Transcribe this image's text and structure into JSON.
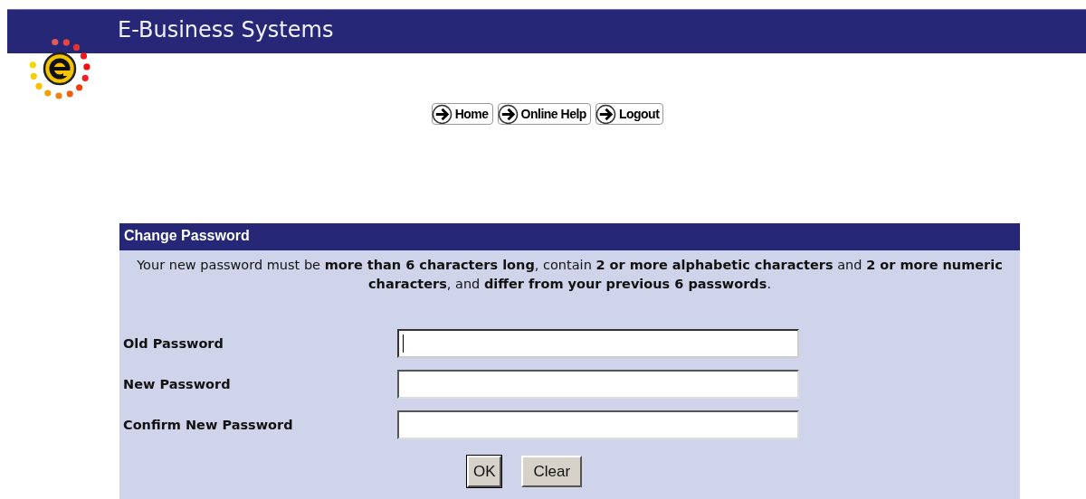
{
  "header": {
    "title": "E-Business Systems"
  },
  "nav": [
    {
      "label": "Home"
    },
    {
      "label": "Online Help"
    },
    {
      "label": "Logout"
    }
  ],
  "panel": {
    "title": "Change Password",
    "description": "Your new password must be **more than 6 characters long**, contain **2 or more alphabetic characters** and **2 or more numeric characters**, and **differ from your previous 6 passwords**.",
    "fields": [
      {
        "label": "Old Password",
        "focused": true
      },
      {
        "label": "New Password",
        "focused": false
      },
      {
        "label": "Confirm New Password",
        "focused": false
      }
    ],
    "buttons": [
      {
        "label": "OK",
        "default": true
      },
      {
        "label": "Clear",
        "default": false
      }
    ]
  }
}
